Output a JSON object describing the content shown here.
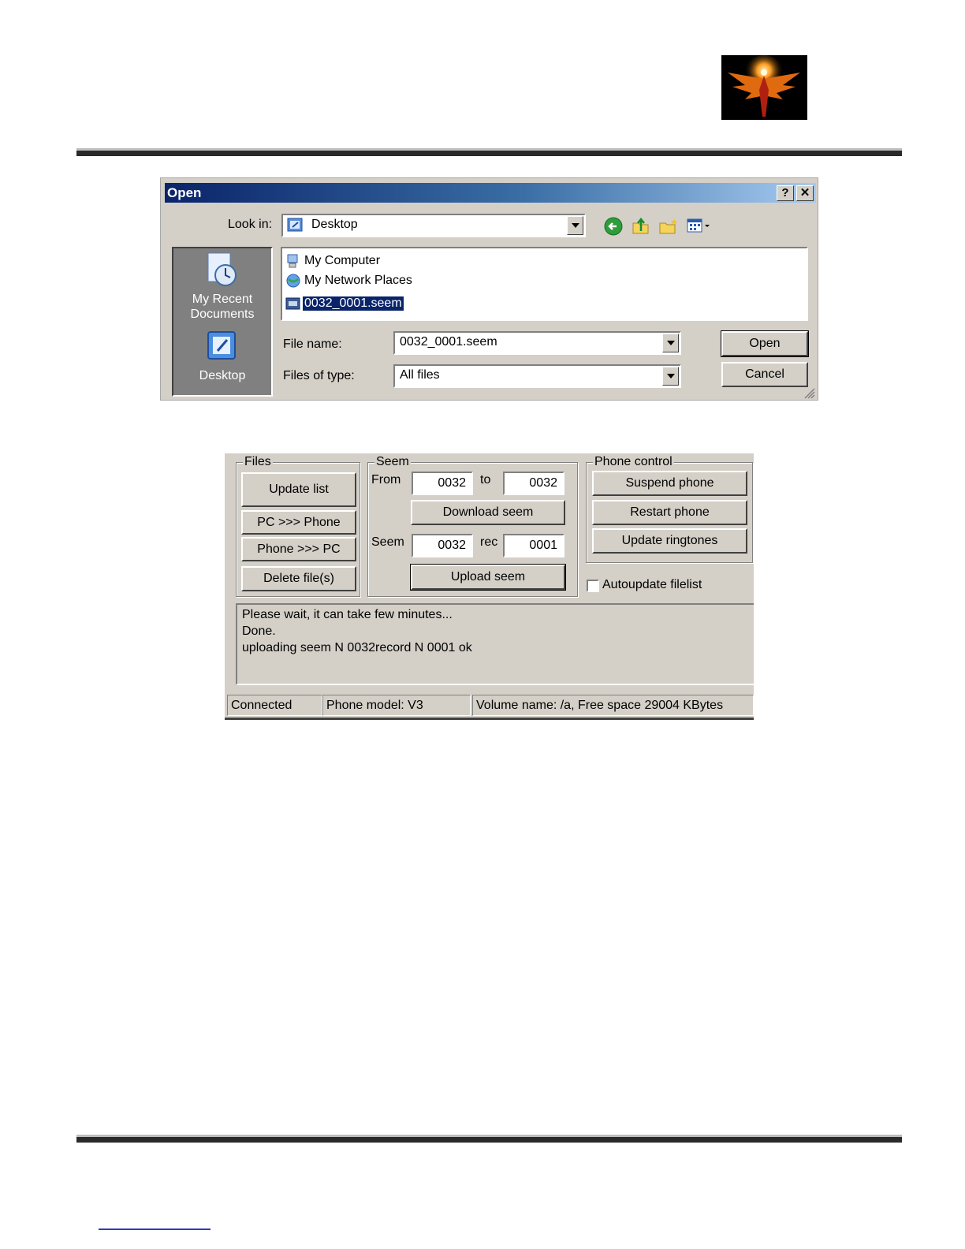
{
  "dialog": {
    "title": "Open",
    "help_button": "?",
    "close_button": "✕",
    "look_in_label": "Look in:",
    "look_in_value": "Desktop",
    "places": [
      {
        "label_line1": "My Recent",
        "label_line2": "Documents"
      },
      {
        "label_line1": "Desktop",
        "label_line2": ""
      }
    ],
    "files": [
      "My Computer",
      "My Network Places",
      "0032_0001.seem"
    ],
    "file_name_label": "File name:",
    "file_name_value": "0032_0001.seem",
    "file_type_label": "Files of type:",
    "file_type_value": "All files",
    "open_button": "Open",
    "cancel_button": "Cancel"
  },
  "panel": {
    "files_group": {
      "title": "Files",
      "buttons": [
        "Update list",
        "PC >>> Phone",
        "Phone >>> PC",
        "Delete file(s)"
      ]
    },
    "seem_group": {
      "title": "Seem",
      "from_label": "From",
      "from_value": "0032",
      "to_label": "to",
      "to_value": "0032",
      "download_button": "Download seem",
      "seem_label": "Seem",
      "seem_value": "0032",
      "rec_label": "rec",
      "rec_value": "0001",
      "upload_button": "Upload seem"
    },
    "phone_group": {
      "title": "Phone control",
      "buttons": [
        "Suspend phone",
        "Restart phone",
        "Update ringtones"
      ]
    },
    "autoupdate_label": "Autoupdate filelist",
    "autoupdate_checked": false,
    "log_lines": [
      "Please wait, it can take few minutes...",
      "Done.",
      "uploading seem N 0032record N 0001 ok"
    ],
    "status": {
      "connection": "Connected",
      "model": "Phone model: V3",
      "volume": "Volume name: /a, Free space 29004 KBytes"
    }
  }
}
